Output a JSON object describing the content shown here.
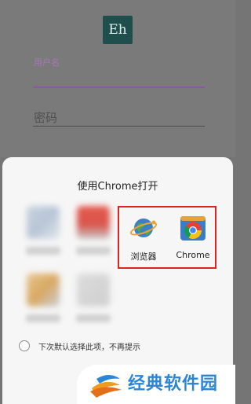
{
  "login": {
    "logo_text": "Eh",
    "username_label": "用户名",
    "password_placeholder": "密码"
  },
  "chooser": {
    "title": "使用Chrome打开",
    "apps": [
      {
        "label": "浏览器",
        "icon": "globe-browser-icon"
      },
      {
        "label": "Chrome",
        "icon": "chrome-icon"
      }
    ],
    "default_option_label": "下次默认选择此项，不再提示",
    "default_option_checked": false,
    "highlight_color": "#e0231b"
  },
  "watermark": {
    "text": "经典软件园"
  }
}
